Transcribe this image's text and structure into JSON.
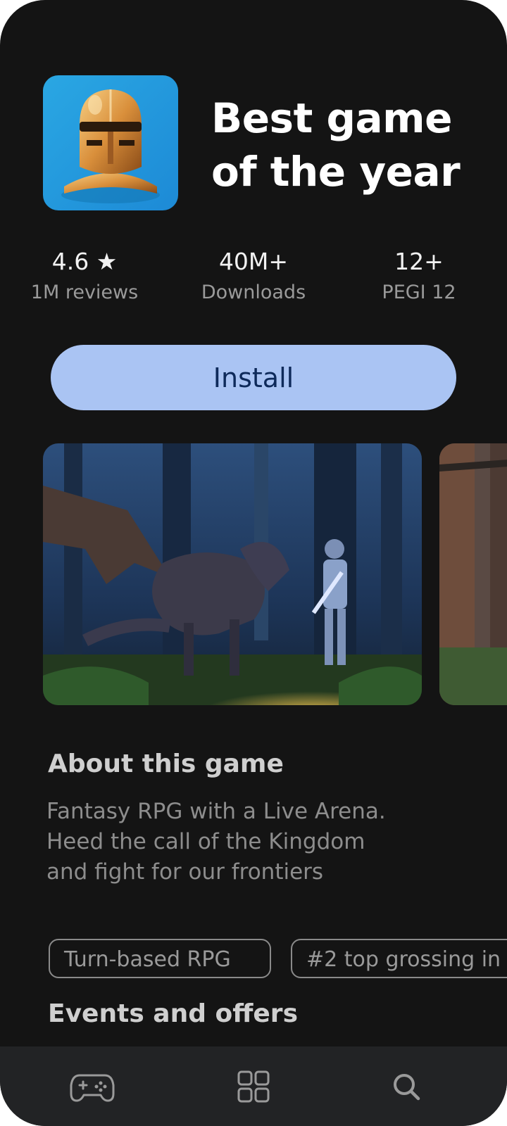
{
  "app": {
    "title_line1": "Best game",
    "title_line2": "of the year",
    "icon": "knight-helmet-icon"
  },
  "stats": [
    {
      "value": "4.6 ★",
      "label": "1M reviews"
    },
    {
      "value": "40M+",
      "label": "Downloads"
    },
    {
      "value": "12+",
      "label": "PEGI 12"
    }
  ],
  "install": {
    "label": "Install"
  },
  "screenshots": [
    {
      "name": "knight-vs-dragon-forest"
    },
    {
      "name": "forest-screenshot-partial"
    }
  ],
  "about": {
    "title": "About this game",
    "line1": "Fantasy RPG with a Live Arena.",
    "line2": "Heed the call of the Kingdom",
    "line3": "and fight for our frontiers"
  },
  "chips": [
    "Turn-based RPG",
    "#2 top grossing in"
  ],
  "events": {
    "title": "Events and offers"
  },
  "nav": {
    "items": [
      {
        "icon": "gamepad-icon"
      },
      {
        "icon": "apps-grid-icon"
      },
      {
        "icon": "search-icon"
      }
    ]
  },
  "colors": {
    "background": "#141414",
    "install_button": "#aac4f3",
    "install_text": "#0e2a5a",
    "nav_bar": "#222325"
  }
}
